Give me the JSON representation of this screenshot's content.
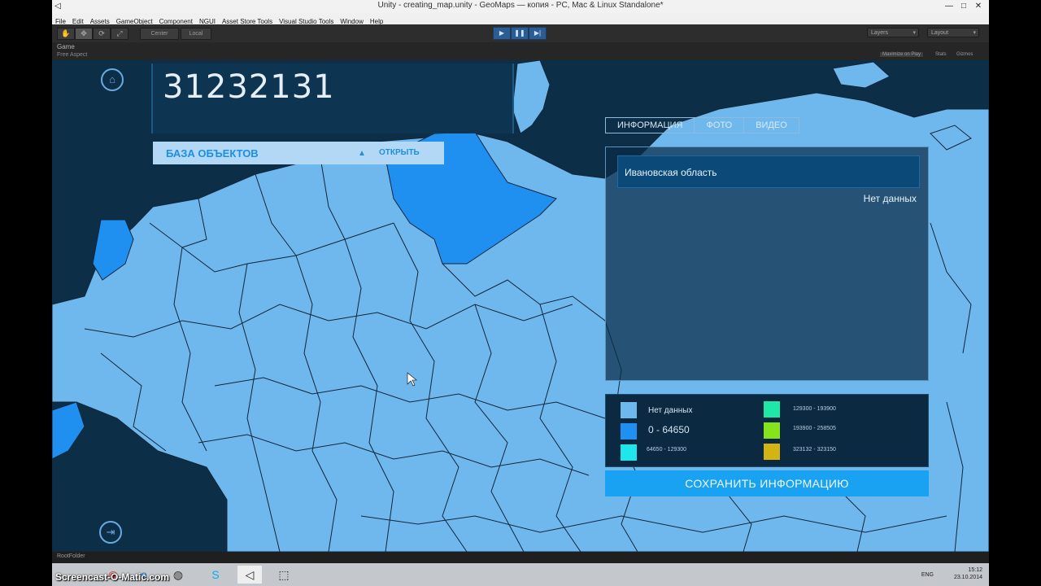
{
  "window": {
    "title": "Unity - creating_map.unity - GeoMaps — копия - PC, Mac & Linux Standalone*",
    "controls": [
      "—",
      "□",
      "✕"
    ]
  },
  "menu": [
    "File",
    "Edit",
    "Assets",
    "GameObject",
    "Component",
    "NGUI",
    "Asset Store Tools",
    "Visual Studio Tools",
    "Window",
    "Help"
  ],
  "toolbar": {
    "center": "Center",
    "local": "Local",
    "layers": "Layers",
    "layout": "Layout"
  },
  "game_tab": {
    "name": "Game",
    "aspect": "Free Aspect",
    "maximize": "Maximize on Play",
    "stats": "Stats",
    "gizmos": "Gizmos"
  },
  "app": {
    "counter": "31232131",
    "objects_label": "БАЗА ОБЪЕКТОВ",
    "open_label": "ОТКРЫТЬ",
    "tabs": [
      "ИНФОРМАЦИЯ",
      "ФОТО",
      "ВИДЕО"
    ],
    "region": "Ивановская область",
    "status": "Нет данных",
    "save_label": "СОХРАНИТЬ ИНФОРМАЦИЮ",
    "legend": [
      {
        "label": "Нет данных",
        "color": "#6fb8ee"
      },
      {
        "label": "0 - 64650",
        "color": "#1f8ff0"
      },
      {
        "label": "64650 - 129300",
        "color": "#1ee6ea"
      },
      {
        "label": "129300 - 193900",
        "color": "#1fe8a6"
      },
      {
        "label": "193900 - 258505",
        "color": "#86e21b"
      },
      {
        "label": "323132 - 323150",
        "color": "#d4b414"
      }
    ]
  },
  "footer": {
    "root": "RootFolder",
    "watermark": "Screencast-O-Matic.com",
    "lang": "ENG",
    "time": "15:12",
    "date": "23.10.2014"
  }
}
